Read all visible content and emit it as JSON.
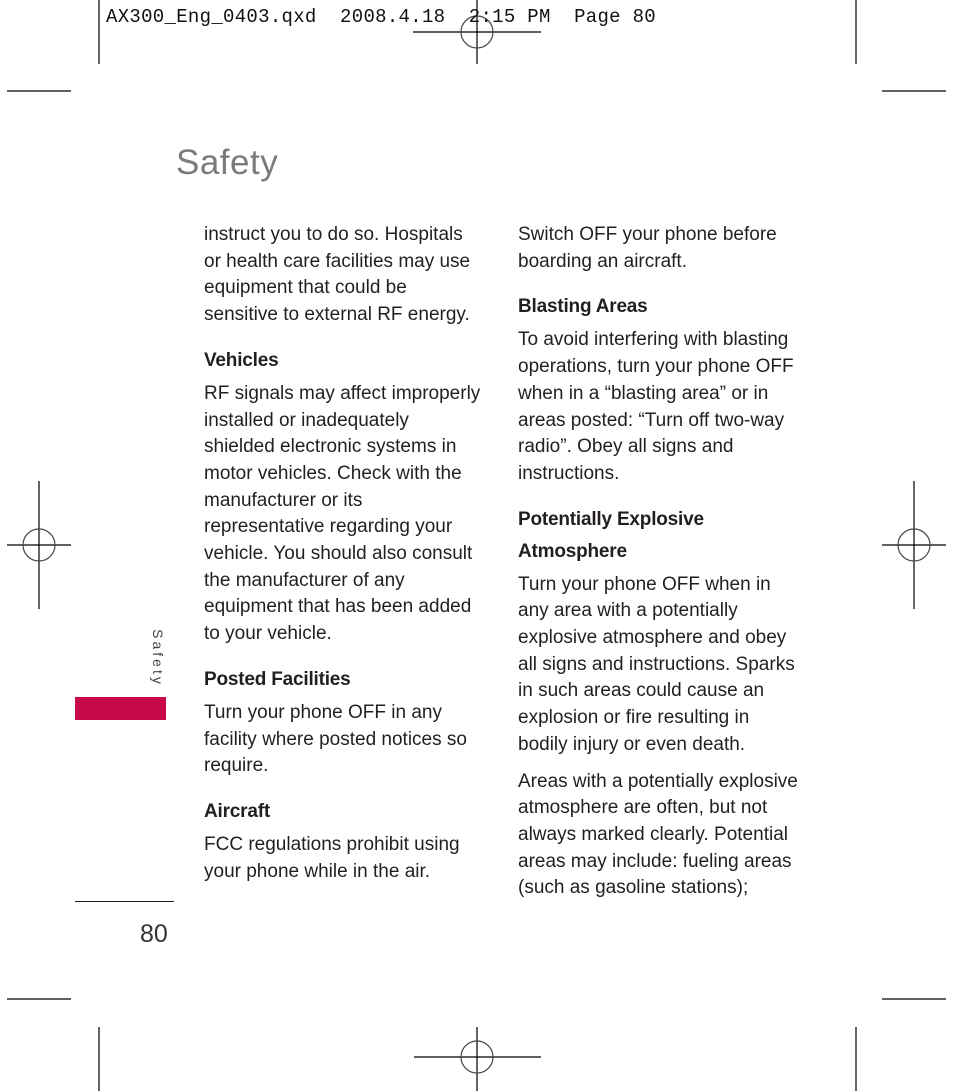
{
  "slug": {
    "text": "AX300_Eng_0403.qxd  2008.4.18  2:15 PM  Page 80"
  },
  "header": {
    "title": "Safety"
  },
  "left_column": {
    "intro": "instruct you to do so. Hospitals or health care facilities may use equipment that could be sensitive to external RF energy.",
    "sections": [
      {
        "heading": "Vehicles",
        "body": "RF signals may affect improperly installed or inadequately shielded electronic systems in motor vehicles. Check with the manufacturer or its representative regarding your vehicle. You should also consult the manufacturer of any equipment that has been added to your vehicle."
      },
      {
        "heading": "Posted Facilities",
        "body": "Turn your phone OFF in any facility where posted notices so require."
      },
      {
        "heading": "Aircraft",
        "body": "FCC regulations prohibit using your phone while in the air."
      }
    ]
  },
  "right_column": {
    "intro": "Switch OFF your phone before boarding an aircraft.",
    "sections": [
      {
        "heading": "Blasting Areas",
        "body": "To avoid interfering with blasting operations, turn your phone OFF when in a “blasting area” or in areas posted: “Turn off two-way radio”. Obey all signs and instructions."
      },
      {
        "heading": "Potentially Explosive Atmosphere",
        "body": "Turn your phone OFF when in any area with a potentially explosive atmosphere and obey all signs and instructions. Sparks in such areas could cause an explosion or fire resulting in bodily injury or even death.",
        "body2": "Areas with a potentially explosive atmosphere are often, but not always marked clearly. Potential areas may include: fueling areas (such as gasoline stations);"
      }
    ]
  },
  "side_tab": {
    "label": "Safety",
    "accent_color": "#c80a4b"
  },
  "footer": {
    "page_number": "80"
  }
}
